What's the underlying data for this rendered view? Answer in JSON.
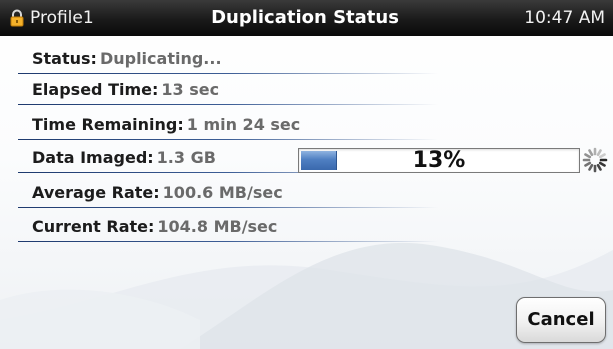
{
  "titlebar": {
    "profile": "Profile1",
    "title": "Duplication Status",
    "time": "10:47 AM",
    "lock_icon": "lock-icon"
  },
  "status": {
    "rows": [
      {
        "label": "Status:",
        "value": "Duplicating..."
      },
      {
        "label": "Elapsed Time:",
        "value": "13 sec"
      },
      {
        "label": "Time Remaining:",
        "value": "1 min 24 sec"
      },
      {
        "label": "Data Imaged:",
        "value": "1.3 GB"
      },
      {
        "label": "Average Rate:",
        "value": "100.6 MB/sec"
      },
      {
        "label": "Current Rate:",
        "value": "104.8 MB/sec"
      }
    ]
  },
  "progress": {
    "percent_text": "13%",
    "fraction": 0.13
  },
  "busy_icon": "spinner-icon",
  "buttons": {
    "cancel": "Cancel"
  },
  "colors": {
    "titlebar": "#1a1a1a",
    "separator": "#1e3a6e",
    "progress_fill": "#4f7fc2",
    "lock": "#f5b12a"
  }
}
